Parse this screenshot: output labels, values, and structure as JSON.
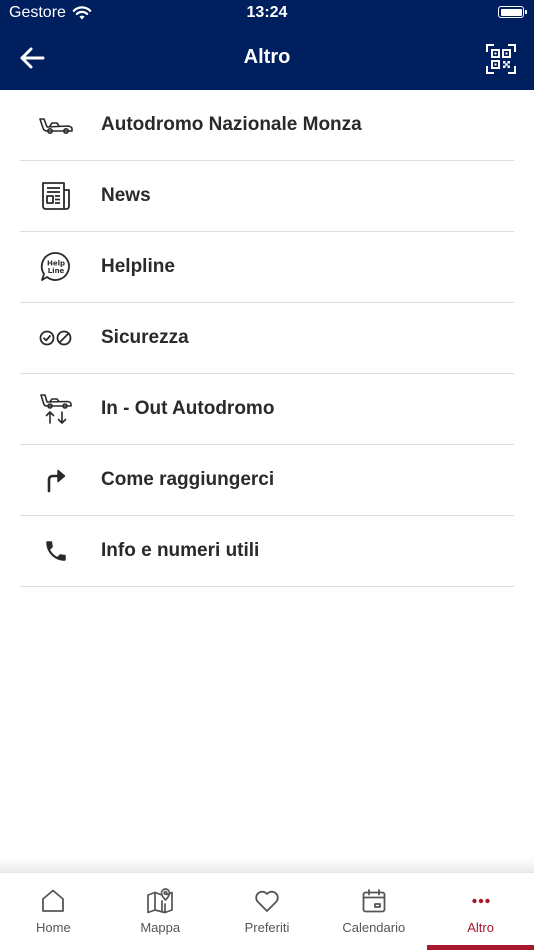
{
  "status_bar": {
    "carrier": "Gestore",
    "time": "13:24"
  },
  "nav": {
    "title": "Altro"
  },
  "menu": {
    "items": [
      {
        "label": "Autodromo Nazionale Monza",
        "icon": "race-car-icon"
      },
      {
        "label": "News",
        "icon": "newspaper-icon"
      },
      {
        "label": "Helpline",
        "icon": "helpline-bubble-icon"
      },
      {
        "label": "Sicurezza",
        "icon": "safety-icon"
      },
      {
        "label": "In - Out Autodromo",
        "icon": "car-in-out-icon"
      },
      {
        "label": "Come raggiungerci",
        "icon": "turn-right-arrow-icon"
      },
      {
        "label": "Info e numeri utili",
        "icon": "phone-icon"
      }
    ],
    "helpline_icon_text": [
      "Help",
      "Line"
    ]
  },
  "tabbar": {
    "tabs": [
      {
        "label": "Home",
        "icon": "home-icon"
      },
      {
        "label": "Mappa",
        "icon": "map-icon"
      },
      {
        "label": "Preferiti",
        "icon": "heart-icon"
      },
      {
        "label": "Calendario",
        "icon": "calendar-icon"
      },
      {
        "label": "Altro",
        "icon": "more-dots-icon",
        "active": true
      }
    ]
  },
  "colors": {
    "header_bg": "#001f5f",
    "accent": "#a6182e",
    "text": "#2a2a2a",
    "divider": "#dddddd"
  }
}
